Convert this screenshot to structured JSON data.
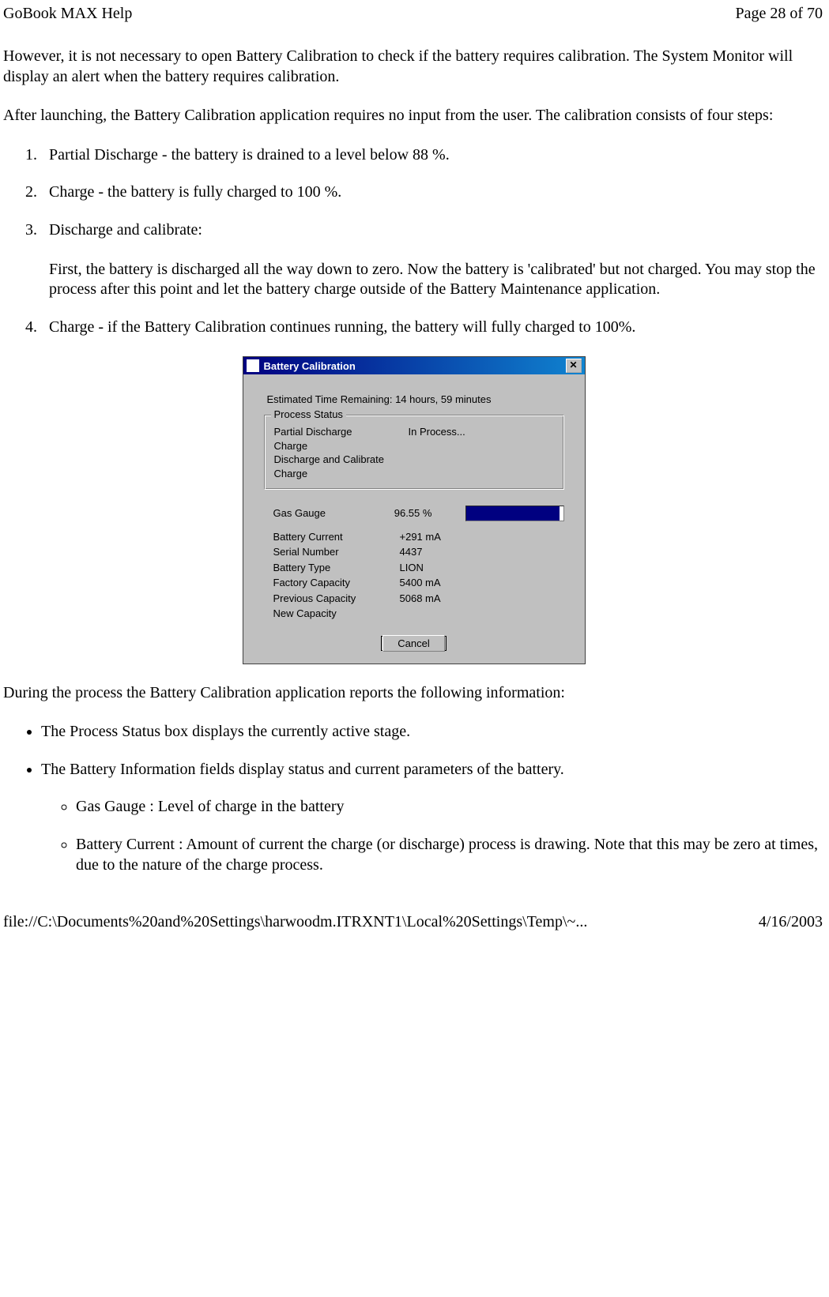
{
  "header": {
    "title": "GoBook MAX Help",
    "page_indicator": "Page 28 of 70"
  },
  "content": {
    "para1": "However, it is not necessary to open Battery Calibration to check if the battery requires calibration.  The System Monitor will display an alert when the battery requires calibration.",
    "para2": "After launching, the Battery Calibration application requires no input from the user. The calibration consists of four steps:",
    "steps": [
      " Partial Discharge - the battery is drained to a level below 88 %.",
      " Charge - the battery is fully charged to 100 %.",
      " Discharge and calibrate:",
      "Charge - if the Battery Calibration continues running, the battery will fully charged to 100%."
    ],
    "step3_sub": "First, the battery is discharged all the way down to zero.  Now the battery is 'calibrated' but not charged. You may stop the process after this point and let the battery charge outside of the Battery Maintenance application.",
    "para3": "During the process the Battery Calibration application reports the following information:",
    "bullets": [
      "The Process Status box displays the currently active stage.",
      "The Battery Information fields display status and current parameters of the battery."
    ],
    "sub_bullets": [
      "Gas Gauge : Level of charge in the battery",
      "Battery Current : Amount of current the charge (or discharge) process is drawing. Note that this may be zero at times, due to the nature of the charge process."
    ]
  },
  "dialog": {
    "title": "Battery Calibration",
    "close": "✕",
    "eta": "Estimated Time Remaining:  14 hours, 59 minutes",
    "group_title": "Process Status",
    "status": [
      {
        "label": "Partial Discharge",
        "val": "In Process..."
      },
      {
        "label": "Charge",
        "val": ""
      },
      {
        "label": "Discharge and Calibrate",
        "val": ""
      },
      {
        "label": "Charge",
        "val": ""
      }
    ],
    "info": [
      {
        "label": "Gas Gauge",
        "val": "96.55 %",
        "gauge": true,
        "pct": 96.55
      },
      {
        "label": "Battery Current",
        "val": "+291 mA"
      },
      {
        "label": "Serial Number",
        "val": "4437"
      },
      {
        "label": "Battery Type",
        "val": "LION"
      },
      {
        "label": "Factory Capacity",
        "val": "5400 mA"
      },
      {
        "label": "Previous Capacity",
        "val": "5068 mA"
      },
      {
        "label": "New Capacity",
        "val": ""
      }
    ],
    "cancel": "Cancel"
  },
  "footer": {
    "path": "file://C:\\Documents%20and%20Settings\\harwoodm.ITRXNT1\\Local%20Settings\\Temp\\~...",
    "date": "4/16/2003"
  }
}
